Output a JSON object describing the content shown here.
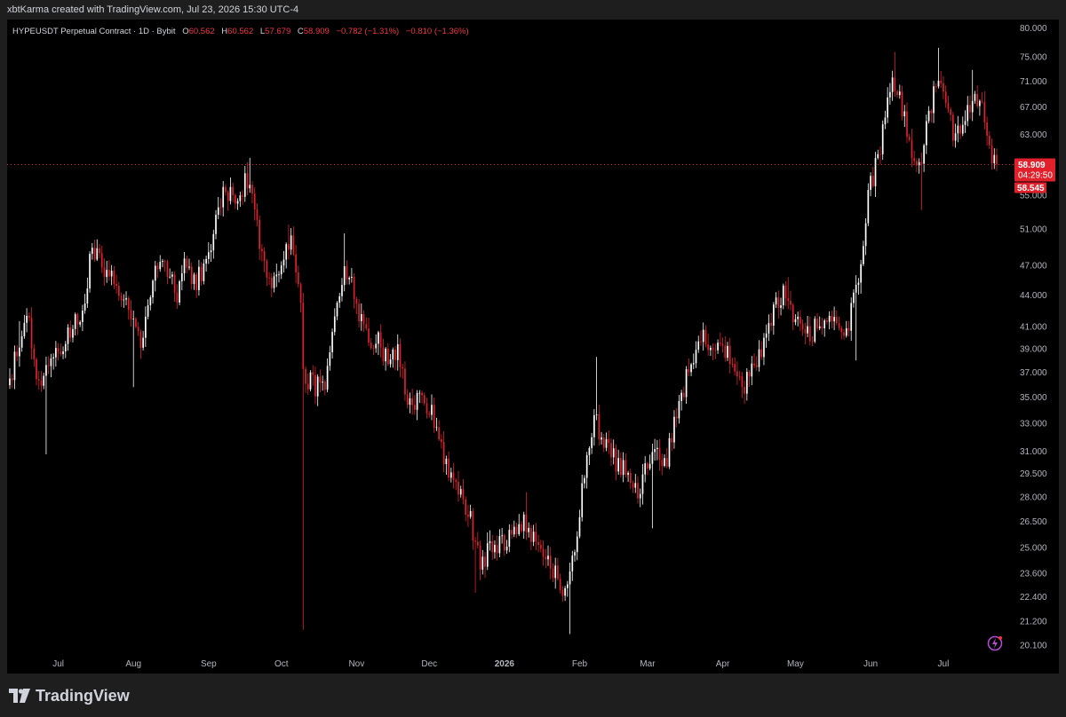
{
  "header": {
    "credit": "xbtKarma created with TradingView.com, Jul 23, 2026 15:30 UTC-4"
  },
  "legend": {
    "symbol": "HYPEUSDT Perpetual Contract · 1D · Bybit",
    "open_label": "O",
    "open": "60.562",
    "high_label": "H",
    "high": "60.562",
    "low_label": "L",
    "low": "57.679",
    "close_label": "C",
    "close": "58.909",
    "change": "−0.782 (−1.31%)",
    "change2": "−0.810 (−1.36%)"
  },
  "price_tags": {
    "last_price": "58.909",
    "countdown": "04:29:50",
    "second_price": "58.545"
  },
  "footer": {
    "brand": "TradingView"
  },
  "colors": {
    "up": "#ffffff",
    "down": "#e0212b",
    "background": "#000000",
    "frame": "#1e1e1e",
    "axis_text": "#b2b5be",
    "tag": "#e0212b"
  },
  "icons": {
    "lightning": "lightning-icon",
    "logo": "tradingview-logo-icon"
  },
  "chart_data": {
    "type": "candlestick",
    "title": "",
    "xlabel": "",
    "ylabel": "",
    "y_scale": "log",
    "ylim": [
      19.7,
      81.5
    ],
    "grid": false,
    "y_ticks": [
      {
        "v": 80,
        "label": "80.000"
      },
      {
        "v": 75,
        "label": "75.000"
      },
      {
        "v": 71,
        "label": "71.000"
      },
      {
        "v": 67,
        "label": "67.000"
      },
      {
        "v": 63,
        "label": "63.000"
      },
      {
        "v": 55,
        "label": "55.000"
      },
      {
        "v": 51,
        "label": "51.000"
      },
      {
        "v": 47,
        "label": "47.000"
      },
      {
        "v": 44,
        "label": "44.000"
      },
      {
        "v": 41,
        "label": "41.000"
      },
      {
        "v": 39,
        "label": "39.000"
      },
      {
        "v": 37,
        "label": "37.000"
      },
      {
        "v": 35,
        "label": "35.000"
      },
      {
        "v": 33,
        "label": "33.000"
      },
      {
        "v": 31,
        "label": "31.000"
      },
      {
        "v": 29.5,
        "label": "29.500"
      },
      {
        "v": 28,
        "label": "28.000"
      },
      {
        "v": 26.5,
        "label": "26.500"
      },
      {
        "v": 25,
        "label": "25.000"
      },
      {
        "v": 23.6,
        "label": "23.600"
      },
      {
        "v": 22.4,
        "label": "22.400"
      },
      {
        "v": 21.2,
        "label": "21.200"
      },
      {
        "v": 20.1,
        "label": "20.100"
      }
    ],
    "x_ticks": [
      {
        "date": "2025-07-01",
        "label": "Jul"
      },
      {
        "date": "2025-08-01",
        "label": "Aug"
      },
      {
        "date": "2025-09-01",
        "label": "Sep"
      },
      {
        "date": "2025-10-01",
        "label": "Oct"
      },
      {
        "date": "2025-11-01",
        "label": "Nov"
      },
      {
        "date": "2025-12-01",
        "label": "Dec"
      },
      {
        "date": "2026-01-01",
        "label": "2026"
      },
      {
        "date": "2026-02-01",
        "label": "Feb"
      },
      {
        "date": "2026-03-01",
        "label": "Mar"
      },
      {
        "date": "2026-04-01",
        "label": "Apr"
      },
      {
        "date": "2026-05-01",
        "label": "May"
      },
      {
        "date": "2026-06-01",
        "label": "Jun"
      },
      {
        "date": "2026-07-01",
        "label": "Jul"
      }
    ],
    "start_date": "2025-06-11",
    "end_date": "2026-07-23",
    "anchors": [
      [
        "2025-06-11",
        36.5
      ],
      [
        "2025-06-16",
        40.5
      ],
      [
        "2025-06-19",
        41.5
      ],
      [
        "2025-06-22",
        36.0
      ],
      [
        "2025-06-28",
        38.5
      ],
      [
        "2025-07-04",
        39.5
      ],
      [
        "2025-07-11",
        42.5
      ],
      [
        "2025-07-15",
        49.0
      ],
      [
        "2025-07-18",
        47.5
      ],
      [
        "2025-07-25",
        45.5
      ],
      [
        "2025-08-02",
        40.5
      ],
      [
        "2025-08-04",
        39.0
      ],
      [
        "2025-08-08",
        44.5
      ],
      [
        "2025-08-13",
        48.0
      ],
      [
        "2025-08-19",
        44.0
      ],
      [
        "2025-08-22",
        47.5
      ],
      [
        "2025-08-26",
        45.0
      ],
      [
        "2025-08-31",
        47.0
      ],
      [
        "2025-09-05",
        53.0
      ],
      [
        "2025-09-08",
        56.0
      ],
      [
        "2025-09-12",
        54.5
      ],
      [
        "2025-09-18",
        57.5
      ],
      [
        "2025-09-22",
        50.0
      ],
      [
        "2025-09-26",
        45.0
      ],
      [
        "2025-09-30",
        46.5
      ],
      [
        "2025-10-05",
        49.5
      ],
      [
        "2025-10-09",
        43.5
      ],
      [
        "2025-10-10",
        37.0
      ],
      [
        "2025-10-14",
        36.0
      ],
      [
        "2025-10-19",
        35.5
      ],
      [
        "2025-10-22",
        39.5
      ],
      [
        "2025-10-27",
        47.5
      ],
      [
        "2025-11-01",
        43.0
      ],
      [
        "2025-11-06",
        40.0
      ],
      [
        "2025-11-10",
        39.5
      ],
      [
        "2025-11-14",
        38.0
      ],
      [
        "2025-11-18",
        39.0
      ],
      [
        "2025-11-22",
        34.0
      ],
      [
        "2025-11-28",
        35.0
      ],
      [
        "2025-12-03",
        33.5
      ],
      [
        "2025-12-09",
        29.5
      ],
      [
        "2025-12-13",
        28.5
      ],
      [
        "2025-12-18",
        26.5
      ],
      [
        "2025-12-22",
        24.3
      ],
      [
        "2025-12-28",
        25.0
      ],
      [
        "2026-01-05",
        25.8
      ],
      [
        "2026-01-08",
        26.5
      ],
      [
        "2026-01-13",
        25.5
      ],
      [
        "2026-01-18",
        24.2
      ],
      [
        "2026-01-22",
        23.6
      ],
      [
        "2026-01-25",
        22.0
      ],
      [
        "2026-01-29",
        24.0
      ],
      [
        "2026-02-04",
        31.0
      ],
      [
        "2026-02-07",
        33.5
      ],
      [
        "2026-02-10",
        32.0
      ],
      [
        "2026-02-15",
        30.5
      ],
      [
        "2026-02-20",
        29.5
      ],
      [
        "2026-02-25",
        28.0
      ],
      [
        "2026-03-03",
        31.0
      ],
      [
        "2026-03-08",
        30.0
      ],
      [
        "2026-03-13",
        33.5
      ],
      [
        "2026-03-18",
        37.5
      ],
      [
        "2026-03-23",
        40.0
      ],
      [
        "2026-03-27",
        39.0
      ],
      [
        "2026-04-03",
        38.5
      ],
      [
        "2026-04-09",
        35.5
      ],
      [
        "2026-04-15",
        38.0
      ],
      [
        "2026-04-22",
        42.5
      ],
      [
        "2026-04-27",
        44.5
      ],
      [
        "2026-05-02",
        41.0
      ],
      [
        "2026-05-08",
        40.5
      ],
      [
        "2026-05-13",
        41.5
      ],
      [
        "2026-05-18",
        42.0
      ],
      [
        "2026-05-22",
        40.5
      ],
      [
        "2026-05-27",
        45.0
      ],
      [
        "2026-05-31",
        55.0
      ],
      [
        "2026-06-05",
        61.0
      ],
      [
        "2026-06-10",
        71.0
      ],
      [
        "2026-06-13",
        69.5
      ],
      [
        "2026-06-17",
        61.0
      ],
      [
        "2026-06-21",
        58.0
      ],
      [
        "2026-06-24",
        64.0
      ],
      [
        "2026-06-28",
        71.5
      ],
      [
        "2026-07-02",
        67.0
      ],
      [
        "2026-07-06",
        62.5
      ],
      [
        "2026-07-10",
        65.0
      ],
      [
        "2026-07-14",
        69.5
      ],
      [
        "2026-07-18",
        66.0
      ],
      [
        "2026-07-21",
        60.0
      ],
      [
        "2026-07-23",
        58.909
      ]
    ],
    "extremes": [
      {
        "date": "2025-06-15",
        "type": "high",
        "v": 41.5
      },
      {
        "date": "2025-06-26",
        "type": "low",
        "v": 30.8
      },
      {
        "date": "2025-07-16",
        "type": "high",
        "v": 49.8
      },
      {
        "date": "2025-08-01",
        "type": "low",
        "v": 35.8
      },
      {
        "date": "2025-09-18",
        "type": "high",
        "v": 59.8
      },
      {
        "date": "2025-10-04",
        "type": "high",
        "v": 51.5
      },
      {
        "date": "2025-10-10",
        "type": "low",
        "v": 20.8
      },
      {
        "date": "2025-10-27",
        "type": "high",
        "v": 50.5
      },
      {
        "date": "2025-12-20",
        "type": "low",
        "v": 22.6
      },
      {
        "date": "2026-01-10",
        "type": "high",
        "v": 28.3
      },
      {
        "date": "2026-01-28",
        "type": "low",
        "v": 20.6
      },
      {
        "date": "2026-02-08",
        "type": "high",
        "v": 38.3
      },
      {
        "date": "2026-03-03",
        "type": "low",
        "v": 26.1
      },
      {
        "date": "2026-04-28",
        "type": "high",
        "v": 45.8
      },
      {
        "date": "2026-05-26",
        "type": "low",
        "v": 38.0
      },
      {
        "date": "2026-06-11",
        "type": "high",
        "v": 75.8
      },
      {
        "date": "2026-06-22",
        "type": "low",
        "v": 53.2
      },
      {
        "date": "2026-06-29",
        "type": "high",
        "v": 76.5
      },
      {
        "date": "2026-07-13",
        "type": "high",
        "v": 72.8
      }
    ],
    "last_price": 58.909,
    "second_price": 58.545
  }
}
